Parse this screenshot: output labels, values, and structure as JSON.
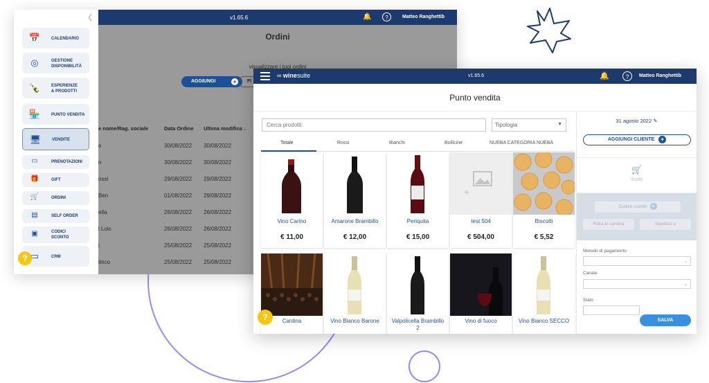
{
  "back_window": {
    "version": "v1.65.6",
    "user": "Matteo Ranghettib",
    "title": "Ordini",
    "subtitle": "visualizzare i tuoi ordini",
    "add_label": "AGGIUNGI",
    "filter_label": "FI",
    "table": {
      "headers": [
        "e nome/Rag. sociale",
        "Data Ordine",
        "Ultima modifica ↓"
      ],
      "rows": [
        {
          "name": "e",
          "date": "30/08/2022",
          "modified": "30/08/2022"
        },
        {
          "name": "n",
          "date": "30/08/2022",
          "modified": "30/08/2022"
        },
        {
          "name": "ossi",
          "date": "29/08/2022",
          "modified": "29/08/2022"
        },
        {
          "name": "Ben",
          "date": "01/08/2022",
          "modified": "29/08/2022"
        },
        {
          "name": "ella",
          "date": "26/08/2022",
          "modified": "26/08/2022"
        },
        {
          "name": "i Lois",
          "date": "26/08/2022",
          "modified": "26/08/2022"
        },
        {
          "name": "i",
          "date": "25/08/2022",
          "modified": "25/08/2022"
        },
        {
          "name": "iteco",
          "date": "25/08/2022",
          "modified": "25/08/2022"
        }
      ]
    }
  },
  "sidebar": {
    "collapse_icon": "chevron-left-icon",
    "items": [
      {
        "label": "CALENDARIO",
        "icon": "calendar-icon",
        "glyph": "📅"
      },
      {
        "label": "GESTIONE\nDISPONIBILITÀ",
        "icon": "availability-icon",
        "glyph": "◎"
      },
      {
        "label": "ESPERIENZE\n& PRODOTTI",
        "icon": "wine-bottles-icon",
        "glyph": "🍾"
      },
      {
        "label": "PUNTO VENDITA",
        "icon": "shop-icon",
        "glyph": "🏪"
      },
      {
        "label": "VENDITE",
        "icon": "register-icon",
        "glyph": "🖥"
      },
      {
        "label": "PRENOTAZIONI",
        "icon": "booking-icon",
        "glyph": "▭"
      },
      {
        "label": "GIFT",
        "icon": "gift-icon",
        "glyph": "🎁"
      },
      {
        "label": "ORDINI",
        "icon": "cart-icon",
        "glyph": "🛒"
      },
      {
        "label": "SELF ORDER",
        "icon": "self-order-icon",
        "glyph": "▤"
      },
      {
        "label": "CODICI\nSCONTO",
        "icon": "coupon-icon",
        "glyph": "▣"
      },
      {
        "label": "CRM",
        "icon": "crm-icon",
        "glyph": "▭"
      }
    ],
    "help": "?"
  },
  "front_window": {
    "brand_prefix": "wine",
    "brand_suffix": "suite",
    "version": "v1.65.6",
    "user": "Matteo Ranghettib",
    "title": "Punto vendita",
    "search_placeholder": "Cerca prodotti",
    "type_select": "Tipologia",
    "tabs": [
      "Totale",
      "Rossi",
      "Bianchi",
      "Bollicine",
      "NUEBA CATEGORIA NUEBA"
    ],
    "products_row1": [
      {
        "name": "Vino Carino",
        "price": "€ 11,00",
        "image": "red-wine-bottle"
      },
      {
        "name": "Amarone Brambillo",
        "price": "€ 12,00",
        "image": "dark-wine-bottle"
      },
      {
        "name": "Periquita",
        "price": "€ 15,00",
        "image": "red-label-wine-bottle"
      },
      {
        "name": "test 504",
        "price": "€ 504,00",
        "image": "placeholder"
      },
      {
        "name": "Biscotti",
        "price": "€ 5,52",
        "image": "cookies"
      }
    ],
    "products_row2": [
      {
        "name": "Cantina",
        "image": "wine-cellar"
      },
      {
        "name": "Vino Bianco Barone",
        "image": "white-wine-bottle"
      },
      {
        "name": "Valpolicella Brambillo\n2",
        "image": "dark-wine-bottle"
      },
      {
        "name": "Vino di fuoco",
        "image": "wine-glass-dark"
      },
      {
        "name": "Vino Bianco SECCO",
        "image": "white-wine-bottle"
      }
    ],
    "help": "?"
  },
  "right_panel": {
    "date": "31 agosto 2022",
    "add_client": "AGGIUNGI CLIENTE",
    "empty_cart": "Vuoto",
    "discount_code": "Codice sconto",
    "pickup": "Ritira in cantina",
    "ship": "Spedisci a",
    "payment_label": "Metodo di pagamento",
    "channel_label": "Canale",
    "state_label": "Stato",
    "save": "SALVA"
  },
  "colors": {
    "navy": "#1d3a6e",
    "accent_blue": "#1d4f9a",
    "save_blue": "#3b8fe0",
    "help_yellow": "#f5c518",
    "deco_purple": "#9b87f0"
  }
}
